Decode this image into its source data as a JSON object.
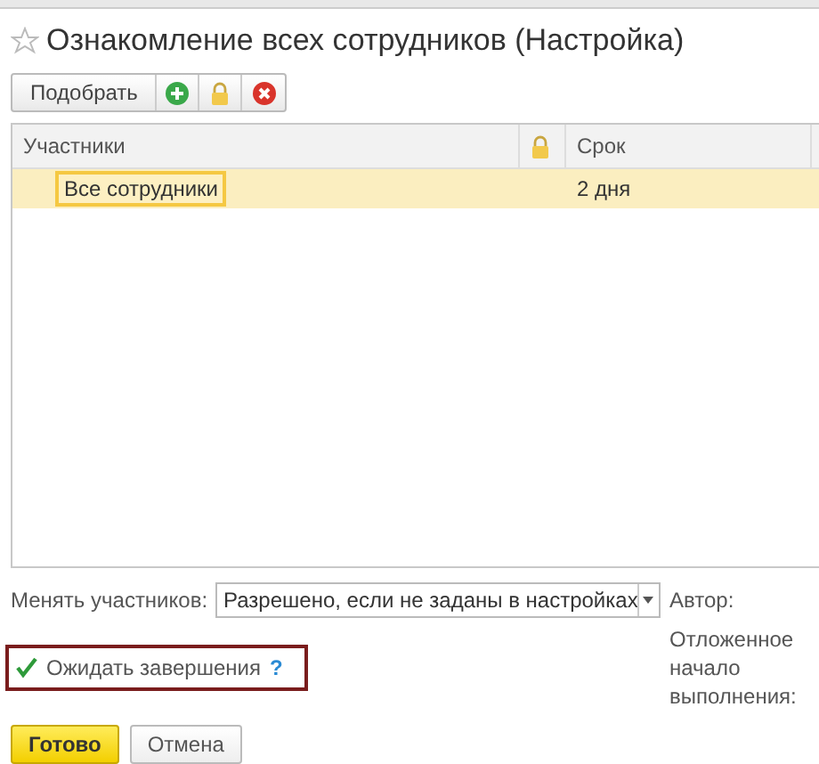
{
  "window": {
    "title": "Ознакомление всех сотрудников (Настройка)",
    "favorite": false
  },
  "toolbar": {
    "pick_button": "Подобрать"
  },
  "table": {
    "columns": [
      "Участники",
      "Срок"
    ],
    "rows": [
      {
        "participants": "Все сотрудники",
        "term": "2 дня",
        "selected": true
      }
    ]
  },
  "change_participants": {
    "label": "Менять участников:",
    "value": "Разрешено, если не заданы в настройках"
  },
  "author": {
    "label": "Автор:"
  },
  "wait_completion": {
    "label": "Ожидать завершения",
    "checked": true,
    "help": "?"
  },
  "delayed_start": {
    "label": "Отложенное начало выполнения:"
  },
  "buttons": [
    {
      "label": "Готово",
      "kind": "primary"
    },
    {
      "label": "Отмена",
      "kind": "secondary"
    }
  ]
}
